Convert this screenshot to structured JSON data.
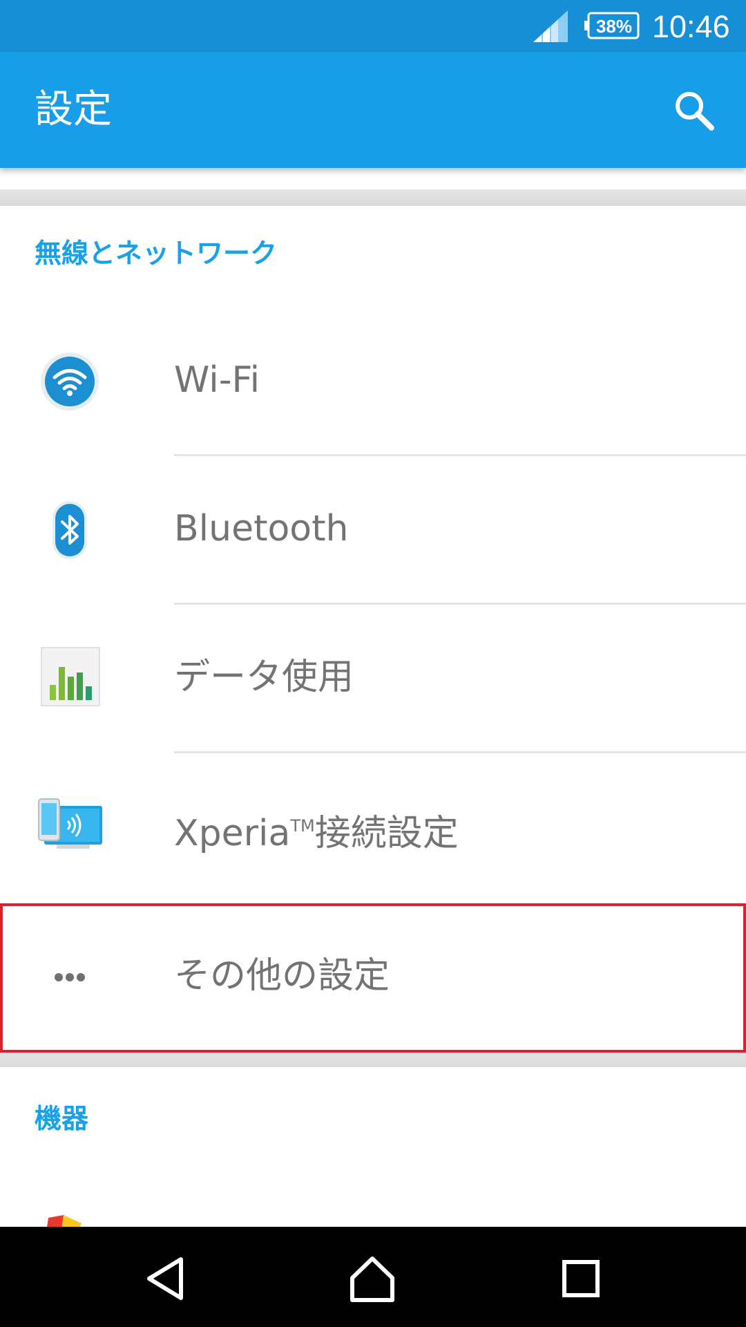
{
  "status_bar": {
    "battery_text": "38%",
    "clock": "10:46"
  },
  "app_bar": {
    "title": "設定",
    "search_icon": "search-icon"
  },
  "sections": [
    {
      "header": "無線とネットワーク",
      "items": [
        {
          "label": "Wi-Fi",
          "icon": "wifi-icon"
        },
        {
          "label": "Bluetooth",
          "icon": "bluetooth-icon"
        },
        {
          "label": "データ使用",
          "icon": "data-usage-icon"
        },
        {
          "label_main": "Xperia",
          "label_sup": "TM",
          "label_rest": "接続設定",
          "icon": "xperia-connectivity-icon"
        },
        {
          "label": "その他の設定",
          "icon": "more-icon",
          "highlighted": true
        }
      ]
    },
    {
      "header": "機器",
      "items": []
    }
  ],
  "nav_bar": {
    "back_icon": "back-icon",
    "home_icon": "home-icon",
    "recents_icon": "recents-icon"
  },
  "colors": {
    "status_bar": "#168fd6",
    "app_bar": "#189ee8",
    "section_header": "#18a0e9",
    "highlight_border": "#e01f2b"
  }
}
